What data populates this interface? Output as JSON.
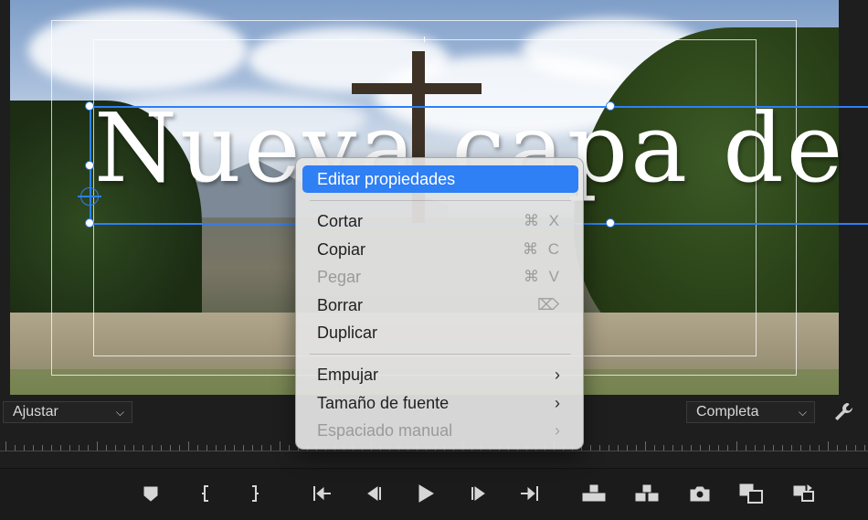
{
  "monitor": {
    "title_overlay": "Nueva capa de"
  },
  "controls": {
    "zoom_select": "Ajustar",
    "quality_select": "Completa",
    "settings_icon": "wrench-icon"
  },
  "context_menu": {
    "items": [
      {
        "label": "Editar propiedades",
        "shortcut": "",
        "state": "highlighted"
      },
      {
        "label": "Cortar",
        "shortcut": "⌘ X",
        "state": "enabled"
      },
      {
        "label": "Copiar",
        "shortcut": "⌘ C",
        "state": "enabled"
      },
      {
        "label": "Pegar",
        "shortcut": "⌘ V",
        "state": "disabled"
      },
      {
        "label": "Borrar",
        "shortcut": "⌦",
        "state": "enabled"
      },
      {
        "label": "Duplicar",
        "shortcut": "",
        "state": "enabled"
      },
      {
        "label": "Empujar",
        "shortcut": "›",
        "state": "enabled"
      },
      {
        "label": "Tamaño de fuente",
        "shortcut": "›",
        "state": "enabled"
      },
      {
        "label": "Espaciado manual",
        "shortcut": "›",
        "state": "disabled"
      }
    ]
  },
  "transport": {
    "buttons": [
      "add-marker-icon",
      "mark-in-icon",
      "mark-out-icon",
      "go-to-in-icon",
      "step-back-icon",
      "play-icon",
      "step-forward-icon",
      "go-to-out-icon",
      "lift-icon",
      "extract-icon",
      "export-frame-icon",
      "comparison-view-icon",
      "proxy-toggle-icon"
    ]
  },
  "colors": {
    "selection_blue": "#2f7ff5",
    "bounding_box_blue": "#2d7ff9"
  }
}
